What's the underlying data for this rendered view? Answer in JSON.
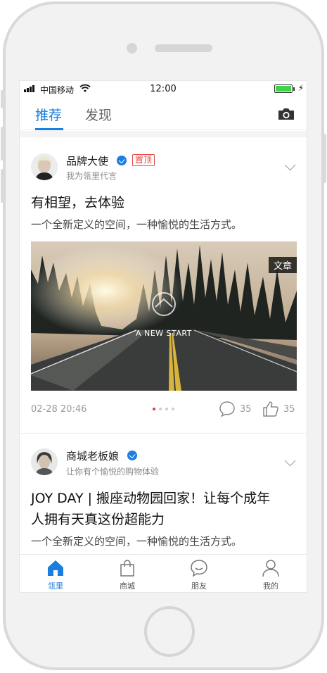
{
  "status_bar": {
    "carrier": "中国移动",
    "time": "12:00"
  },
  "tabs": [
    {
      "label": "推荐",
      "active": true
    },
    {
      "label": "发现",
      "active": false
    }
  ],
  "posts": [
    {
      "author": "品牌大使",
      "badge": "置顶",
      "subtitle": "我为瓴里代言",
      "title": "有相望，去体验",
      "description": "一个全新定义的空间，一种愉悦的生活方式。",
      "image_tag": "文章",
      "image_caption": "A NEW START",
      "date": "02-28 20:46",
      "comments": "35",
      "likes": "35"
    },
    {
      "author": "商城老板娘",
      "subtitle": "让你有个愉悦的购物体验",
      "title_line1": "JOY DAY | 搬座动物园回家！让每个成年",
      "title_line2": "人拥有天真这份超能力",
      "description": "一个全新定义的空间，一种愉悦的生活方式。"
    }
  ],
  "bottom_nav": [
    {
      "label": "瓴里",
      "icon": "home-icon",
      "active": true
    },
    {
      "label": "商城",
      "icon": "shopping-bag-icon",
      "active": false
    },
    {
      "label": "朋友",
      "icon": "chat-bubble-icon",
      "active": false
    },
    {
      "label": "我的",
      "icon": "user-icon",
      "active": false
    }
  ],
  "colors": {
    "accent": "#1a7fe0",
    "pin_red": "#e84545",
    "battery_green": "#3ed34a"
  }
}
